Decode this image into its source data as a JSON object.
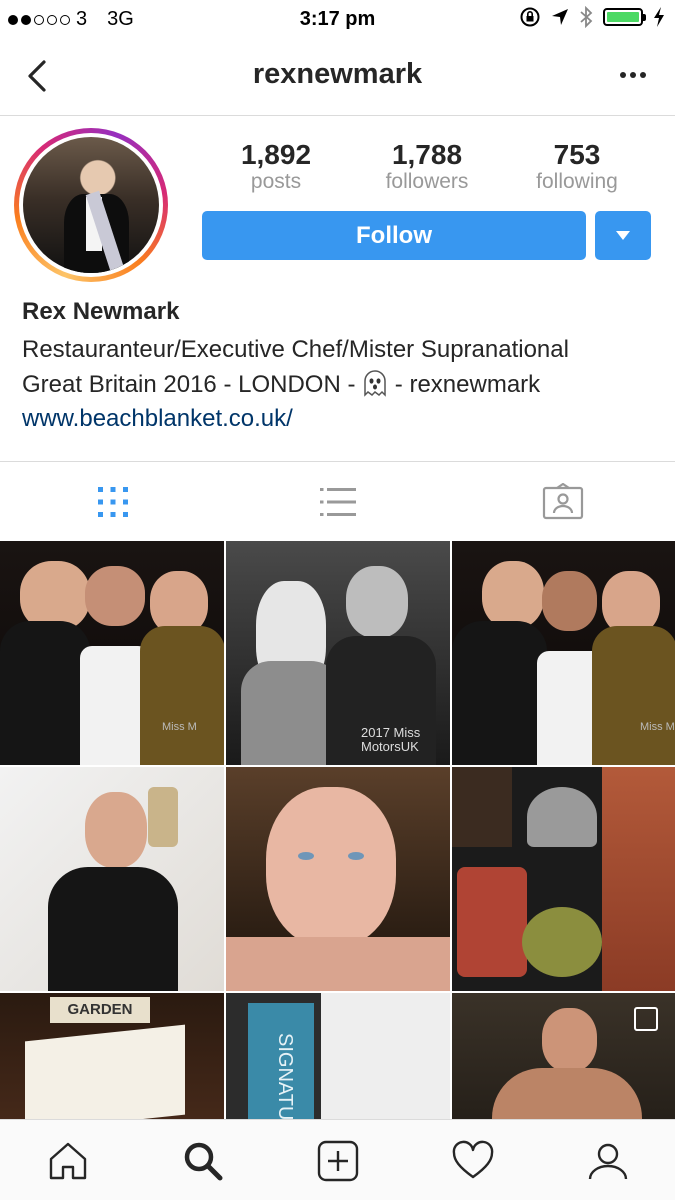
{
  "status_bar": {
    "carrier": "3",
    "network": "3G",
    "time": "3:17 pm",
    "signal_bars_filled": 2,
    "signal_bars_total": 5,
    "battery_level": 1.0,
    "battery_color": "#4cd964"
  },
  "nav": {
    "title": "rexnewmark",
    "back_icon": "chevron-left-icon",
    "more_icon": "more-icon"
  },
  "profile": {
    "stats": [
      {
        "value": "1,892",
        "label": "posts"
      },
      {
        "value": "1,788",
        "label": "followers"
      },
      {
        "value": "753",
        "label": "following"
      }
    ],
    "follow_label": "Follow",
    "accent_color": "#3897f0",
    "name": "Rex Newmark",
    "bio_line1": "Restauranteur/Executive Chef/Mister Supranational",
    "bio_line2_before": "Great Britain 2016 - LONDON - ",
    "bio_line2_after": " - rexnewmark",
    "bio_emoji": "ghost-emoji",
    "website": "www.beachblanket.co.uk/",
    "link_color": "#003569"
  },
  "tabs": [
    {
      "name": "grid-view",
      "icon": "grid-icon",
      "active": true
    },
    {
      "name": "list-view",
      "icon": "list-icon",
      "active": false
    },
    {
      "name": "tagged-view",
      "icon": "tagged-icon",
      "active": false
    }
  ],
  "grid": {
    "tiles": [
      {
        "overlay_text": "Miss M"
      },
      {
        "overlay_text": "2017 Miss MotorsUK"
      },
      {
        "overlay_text": "Miss M"
      },
      {
        "overlay_text": ""
      },
      {
        "overlay_text": ""
      },
      {
        "overlay_text": ""
      },
      {
        "overlay_text": "GARDEN"
      },
      {
        "overlay_text": "SIGNATUR"
      },
      {
        "overlay_text": ""
      }
    ]
  },
  "bottom_bar": [
    {
      "name": "home",
      "icon": "home-icon"
    },
    {
      "name": "search",
      "icon": "search-icon",
      "active": true
    },
    {
      "name": "new-post",
      "icon": "add-icon"
    },
    {
      "name": "activity",
      "icon": "heart-icon"
    },
    {
      "name": "profile",
      "icon": "profile-icon"
    }
  ]
}
